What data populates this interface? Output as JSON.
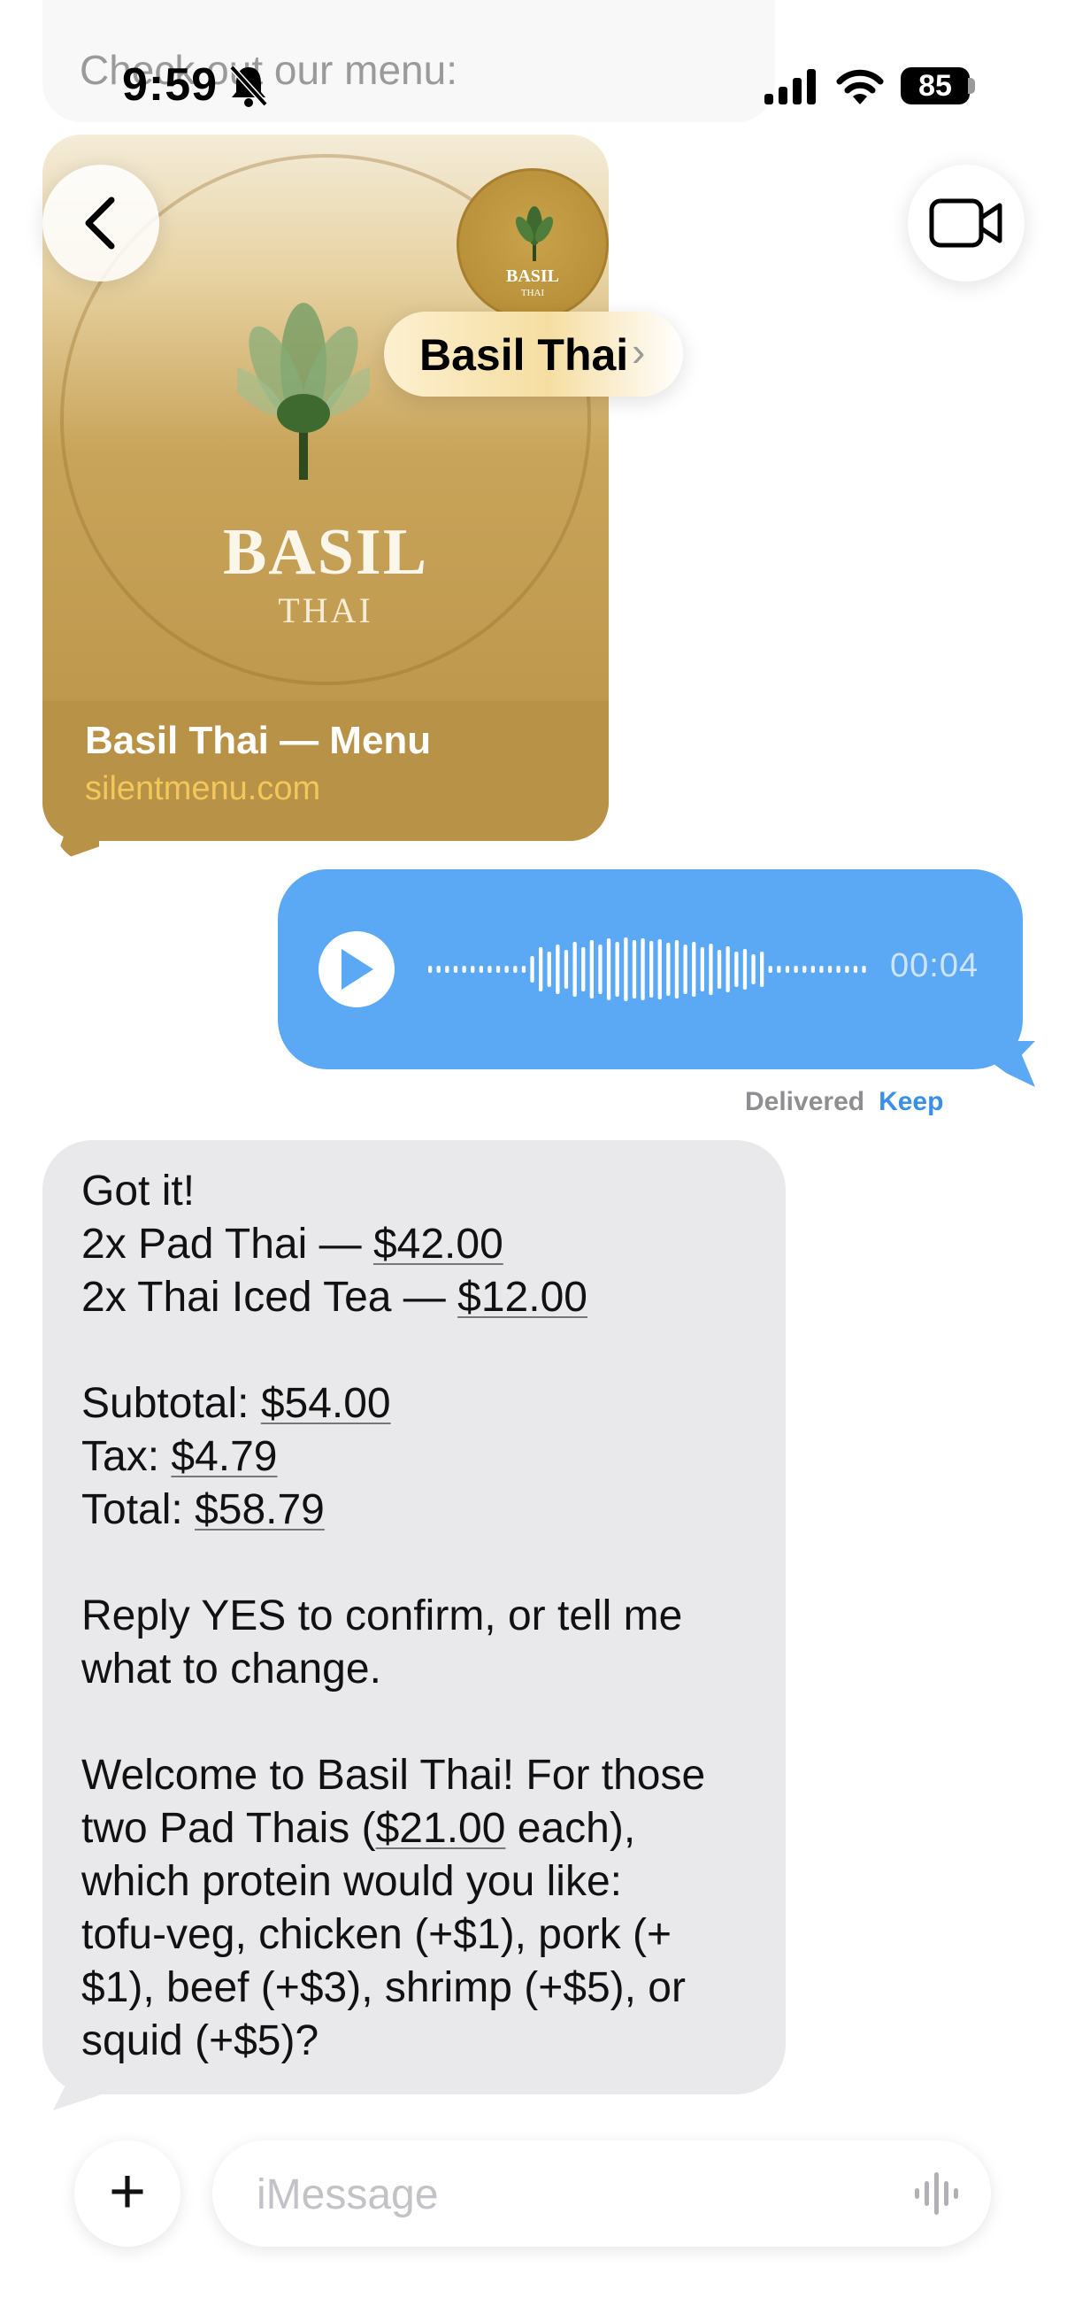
{
  "previous_message": {
    "text": "Check out our menu:"
  },
  "status_bar": {
    "time": "9:59",
    "battery": "85",
    "icons": [
      "bell-slash-icon",
      "signal-icon",
      "wifi-icon",
      "battery-icon"
    ]
  },
  "link_preview": {
    "logo_word": "BASIL",
    "logo_sub": "THAI",
    "title": "Basil Thai — Menu",
    "url": "silentmenu.com"
  },
  "header": {
    "contact_name": "Basil Thai",
    "chevron": "›",
    "avatar_word": "BASIL",
    "avatar_sub": "THAI",
    "back_icon": "chevron-left-icon",
    "video_icon": "video-camera-icon"
  },
  "audio_message": {
    "duration": "00:04",
    "status": "Delivered",
    "keep_label": "Keep"
  },
  "order_message": {
    "lines": [
      "Got it!",
      [
        "2x Pad Thai — ",
        "$42.00"
      ],
      [
        "2x Thai Iced Tea — ",
        "$12.00"
      ],
      "",
      [
        "Subtotal: ",
        "$54.00"
      ],
      [
        "Tax: ",
        "$4.79"
      ],
      [
        "Total: ",
        "$58.79"
      ],
      "",
      "Reply YES to confirm, or tell me",
      "what to change.",
      "",
      "Welcome to Basil Thai! For those",
      [
        "two Pad Thais (",
        "$21.00",
        " each),"
      ],
      "which protein would you like:",
      "tofu-veg, chicken (+$1), pork (+",
      "$1), beef (+$3), shrimp (+$5), or",
      "squid (+$5)?"
    ]
  },
  "input_bar": {
    "placeholder": "iMessage",
    "plus": "+"
  },
  "colors": {
    "sent_bubble": "#5ba8f5",
    "received_bubble": "#e9e9eb",
    "keep_link": "#3a8fe8",
    "card_gold": "#b89246"
  }
}
